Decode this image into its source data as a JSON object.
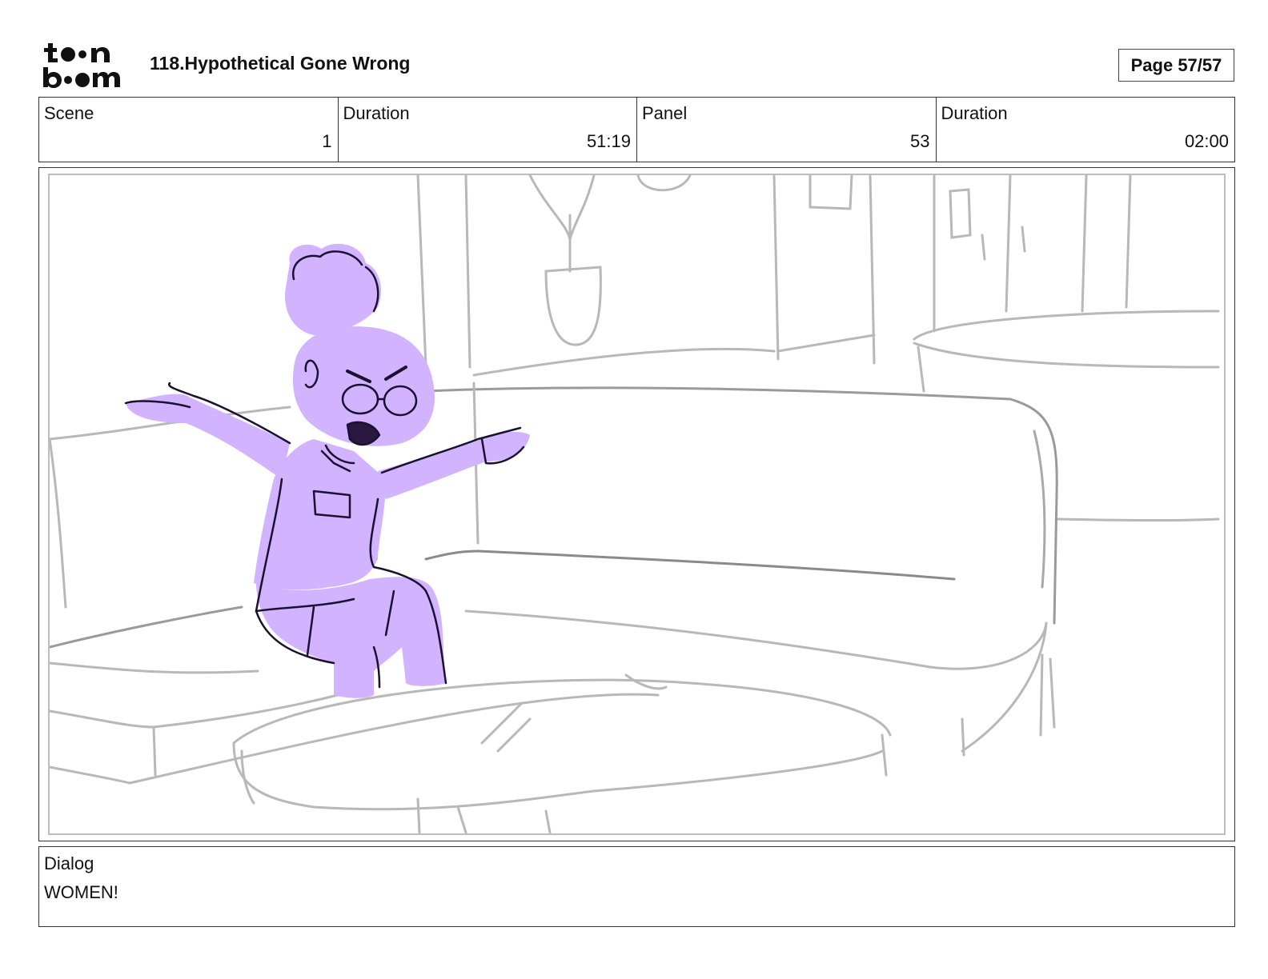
{
  "header": {
    "logo_text_top": "toon",
    "logo_text_bottom": "boom",
    "title": "118.Hypothetical Gone Wrong",
    "page": "Page 57/57"
  },
  "info": [
    {
      "label": "Scene",
      "value": "1"
    },
    {
      "label": "Duration",
      "value": "51:19"
    },
    {
      "label": "Panel",
      "value": "53"
    },
    {
      "label": "Duration",
      "value": "02:00"
    }
  ],
  "panel": {
    "colors": {
      "character_fill": "#d1b3ff",
      "character_line": "#1a1030",
      "background_line": "#b8b8b8"
    }
  },
  "dialog": {
    "label": "Dialog",
    "text": "WOMEN!"
  }
}
